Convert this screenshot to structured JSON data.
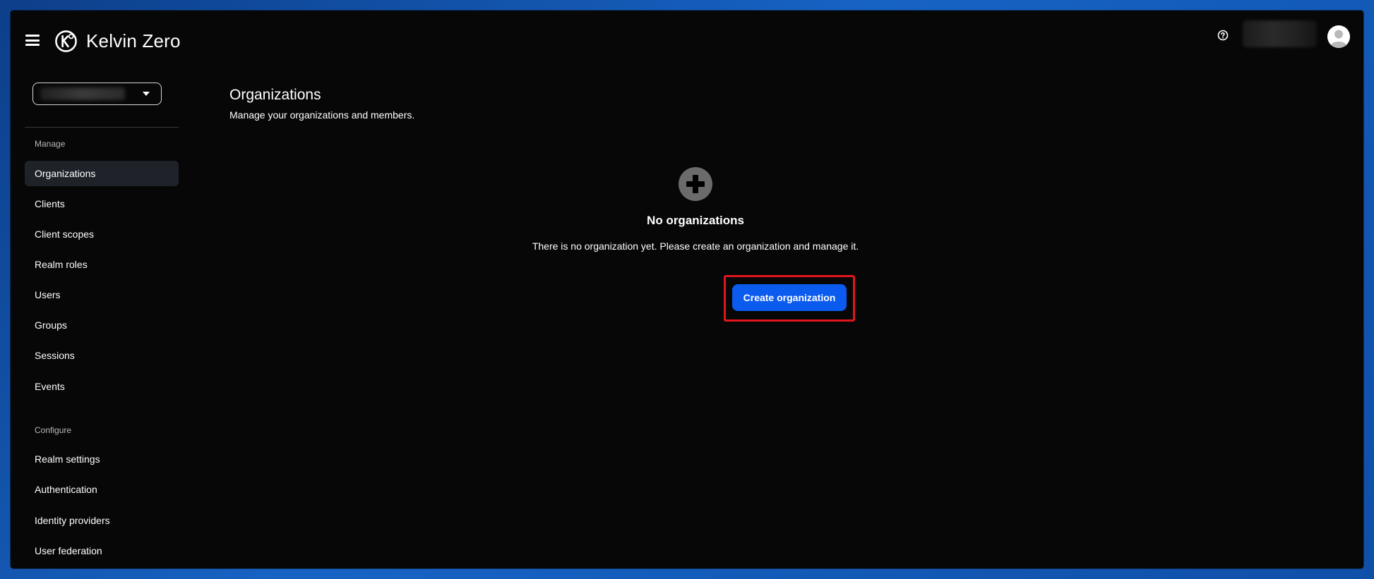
{
  "header": {
    "brand_name": "Kelvin Zero",
    "menu_icon": "hamburger-icon",
    "help_icon": "question-circle-icon",
    "avatar_icon": "user-avatar-icon"
  },
  "sidebar": {
    "realm_selector_icon": "caret-down-icon",
    "sections": [
      {
        "label": "Manage",
        "items": [
          {
            "label": "Organizations",
            "active": true
          },
          {
            "label": "Clients",
            "active": false
          },
          {
            "label": "Client scopes",
            "active": false
          },
          {
            "label": "Realm roles",
            "active": false
          },
          {
            "label": "Users",
            "active": false
          },
          {
            "label": "Groups",
            "active": false
          },
          {
            "label": "Sessions",
            "active": false
          },
          {
            "label": "Events",
            "active": false
          }
        ]
      },
      {
        "label": "Configure",
        "items": [
          {
            "label": "Realm settings",
            "active": false
          },
          {
            "label": "Authentication",
            "active": false
          },
          {
            "label": "Identity providers",
            "active": false
          },
          {
            "label": "User federation",
            "active": false
          }
        ]
      }
    ]
  },
  "main": {
    "title": "Organizations",
    "subtitle": "Manage your organizations and members.",
    "empty_state": {
      "icon": "plus-circle-icon",
      "title": "No organizations",
      "description": "There is no organization yet. Please create an organization and manage it.",
      "button_label": "Create organization"
    }
  },
  "colors": {
    "window_background": "#070707",
    "primary_button": "#0b5bef",
    "highlight_border": "#e3151c",
    "active_nav_background": "#1f2329"
  }
}
